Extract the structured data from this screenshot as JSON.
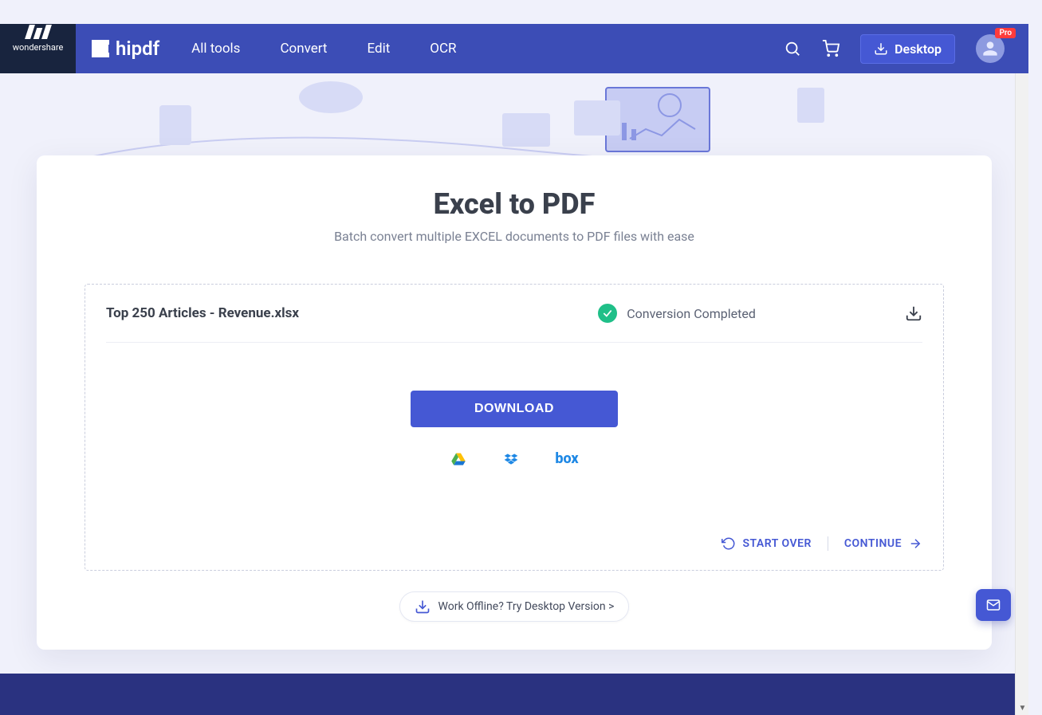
{
  "brand": {
    "parent": "wondershare",
    "name": "hipdf"
  },
  "nav": {
    "items": [
      "All tools",
      "Convert",
      "Edit",
      "OCR"
    ],
    "desktop_label": "Desktop",
    "pro_badge": "Pro"
  },
  "page": {
    "title": "Excel to PDF",
    "subtitle": "Batch convert multiple EXCEL documents to PDF files with ease"
  },
  "file": {
    "name": "Top 250 Articles - Revenue.xlsx",
    "status": "Conversion Completed"
  },
  "buttons": {
    "download": "DOWNLOAD",
    "start_over": "START OVER",
    "continue": "CONTINUE",
    "offline": "Work Offline? Try Desktop Version >"
  },
  "cloud": {
    "box_label": "box"
  }
}
